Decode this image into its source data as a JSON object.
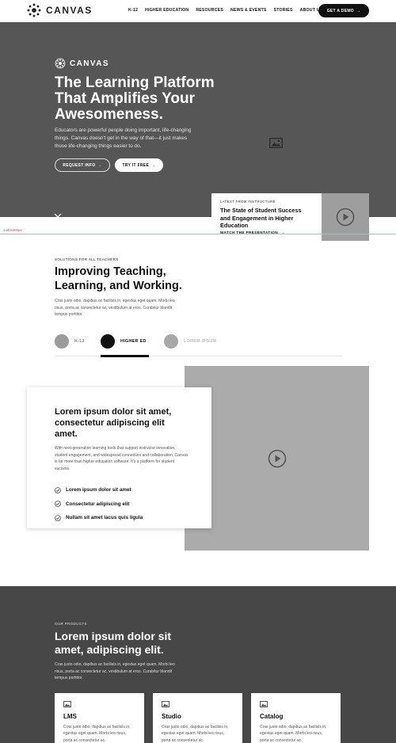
{
  "nav": {
    "logo_text": "CANVAS",
    "links": [
      "K-12",
      "HIGHER EDUCATION",
      "RESOURCES",
      "NEWS & EVENTS",
      "STORIES",
      "ABOUT US"
    ],
    "demo_label": "GET A DEMO"
  },
  "hero": {
    "logo_text": "CANVAS",
    "title": "The Learning Platform That Amplifies Your Awesomeness.",
    "description": "Educators are powerful people doing important, life-changing things. Canvas doesn't get in the way of that—it just makes those life-changing things easier to do.",
    "request_label": "REQUEST INFO",
    "try_label": "TRY IT FREE"
  },
  "featured": {
    "kicker": "LATEST FROM INSTRUCTURE",
    "title": "The State of Student Success and Engagement in Higher Education",
    "link": "WATCH THE PRESENTATION"
  },
  "ruler": {
    "label": "1440x900px"
  },
  "solutions": {
    "kicker": "SOLUTIONS FOR ALL TEACHERS",
    "title": "Improving Teaching, Learning, and Working.",
    "description": "Cras justo odio, dapibus ac facilisis in, egestas eget quam. Morbi leo risus, porta ac consectetur ac, vestibulum at eros. Curabitur blandit tempus porttitor.",
    "tabs": [
      "K-12",
      "HIGHER ED",
      "LOREM IPSUM"
    ],
    "active_tab": "HIGHER ED"
  },
  "content": {
    "title": "Lorem ipsum dolor sit amet, consectetur adipiscing elit amet.",
    "description": "With next-generation learning tools that support instructor innovation, student engagement, and widespread connection and collaboration, Canvas is far more than higher education software. It's a platform for student success.",
    "checks": [
      "Lorem ipsum dolor sit amet",
      "Consectetur adipiscing elit",
      "Nullam sit amet lacus quis ligula"
    ]
  },
  "products": {
    "kicker": "OUR PRODUCTS",
    "title": "Lorem ipsum dolor sit amet, adipiscing elit.",
    "description": "Cras justo odio, dapibus ac facilisis in, egestas eget quam. Morbi leo risus, porta ac consectetur ac, vestibulum at eros. Curabitur blandit tempus porttitor.",
    "cards": [
      {
        "name": "LMS",
        "description": "Cras justo odio, dapibus ac facilisis in, egestas eget quam. Morbi leo risus, porta ac consectetur ac."
      },
      {
        "name": "Studio",
        "description": "Cras justo odio, dapibus ac facilisis in, egestas eget quam. Morbi leo risus, porta ac consectetur ac."
      },
      {
        "name": "Catalog",
        "description": "Cras justo odio, dapibus ac facilisis in, egestas eget quam. Morbi leo risus, porta ac consectetur ac."
      }
    ]
  },
  "colors": {
    "hero_bg": "#565656",
    "products_bg": "#474747",
    "placeholder": "#ababab",
    "ink": "#111111"
  }
}
